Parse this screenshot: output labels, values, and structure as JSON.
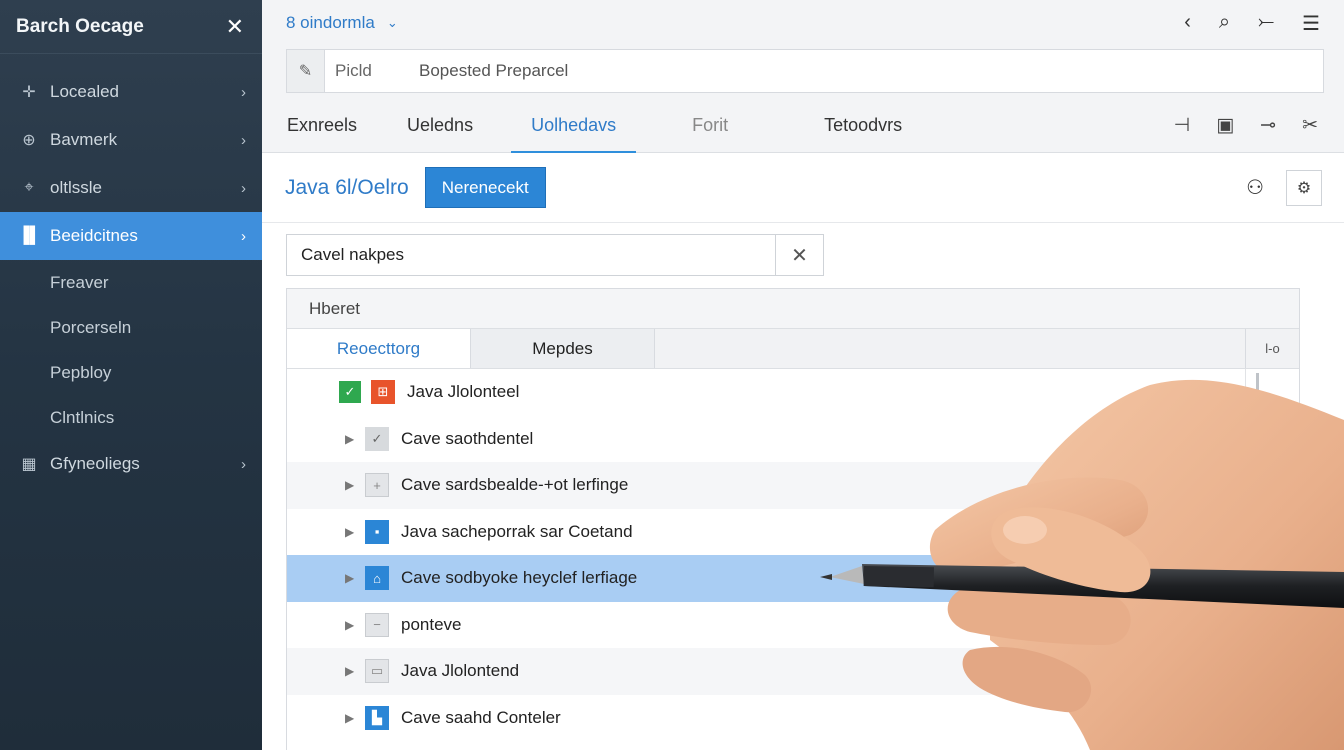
{
  "sidebar": {
    "title": "Barch Oecage",
    "close_icon": "close-icon",
    "items": [
      {
        "label": "Locealed",
        "icon": "plus-cross-icon",
        "chevron": true
      },
      {
        "label": "Bavmerk",
        "icon": "globe-icon",
        "chevron": true
      },
      {
        "label": "oltlssle",
        "icon": "crosshair-icon",
        "chevron": true
      },
      {
        "label": "Beeidcitnes",
        "icon": "folder-icon",
        "chevron": true,
        "active": true
      }
    ],
    "subitems": [
      "Freaver",
      "Porcerseln",
      "Pepbloy",
      "Clntlnics"
    ],
    "bottom_item": {
      "label": "Gfyneoliegs",
      "icon": "grid-icon",
      "chevron": true
    }
  },
  "topbar": {
    "workspace": "8 oindormla",
    "icons": [
      "back-icon",
      "search-icon",
      "minus-icon",
      "menu-icon"
    ]
  },
  "address": {
    "icon": "edit-icon",
    "field1": "Picld",
    "field2": "Bopested Preparcel"
  },
  "tabs": [
    "Exnreels",
    "Ueledns",
    "Uolhedavs",
    "Forit",
    "Tetoodvrs"
  ],
  "tab_icons": [
    "minus-plus-icon",
    "layout-icon",
    "key-icon",
    "tools-icon"
  ],
  "project": {
    "title": "Java 6l/Oelro",
    "new_button": "Nerenecekt"
  },
  "search": {
    "value": "Cavel nakpes"
  },
  "panel": {
    "header": "Hberet",
    "subtabs": [
      "Reoecttorg",
      "Mepdes"
    ],
    "menu_label": "l-o"
  },
  "rows": [
    {
      "label": "Java Jlolonteel",
      "type": "first"
    },
    {
      "label": "Cave saothdentel",
      "icon": "check-icon",
      "style": "gray"
    },
    {
      "label": "Cave sardsbealde-+ot lerfinge",
      "icon": "plus-icon",
      "style": "lgray",
      "alt": true
    },
    {
      "label": "Java sacheporrak sar Coetand",
      "icon": "square-icon",
      "style": "blue"
    },
    {
      "label": "Cave sodbyoke heyclef lerfiage",
      "icon": "home-icon",
      "style": "blue",
      "selected": true
    },
    {
      "label": "ponteve",
      "icon": "minus-icon",
      "style": "lgray"
    },
    {
      "label": "Java Jlolontend",
      "icon": "doc-icon",
      "style": "lgray",
      "alt": true
    },
    {
      "label": "Cave saahd Conteler",
      "icon": "bookmark-icon",
      "style": "blue"
    }
  ],
  "colors": {
    "sidebar_bg": "#243443",
    "accent": "#2c86d6",
    "selected_row": "#a9cdf3"
  }
}
